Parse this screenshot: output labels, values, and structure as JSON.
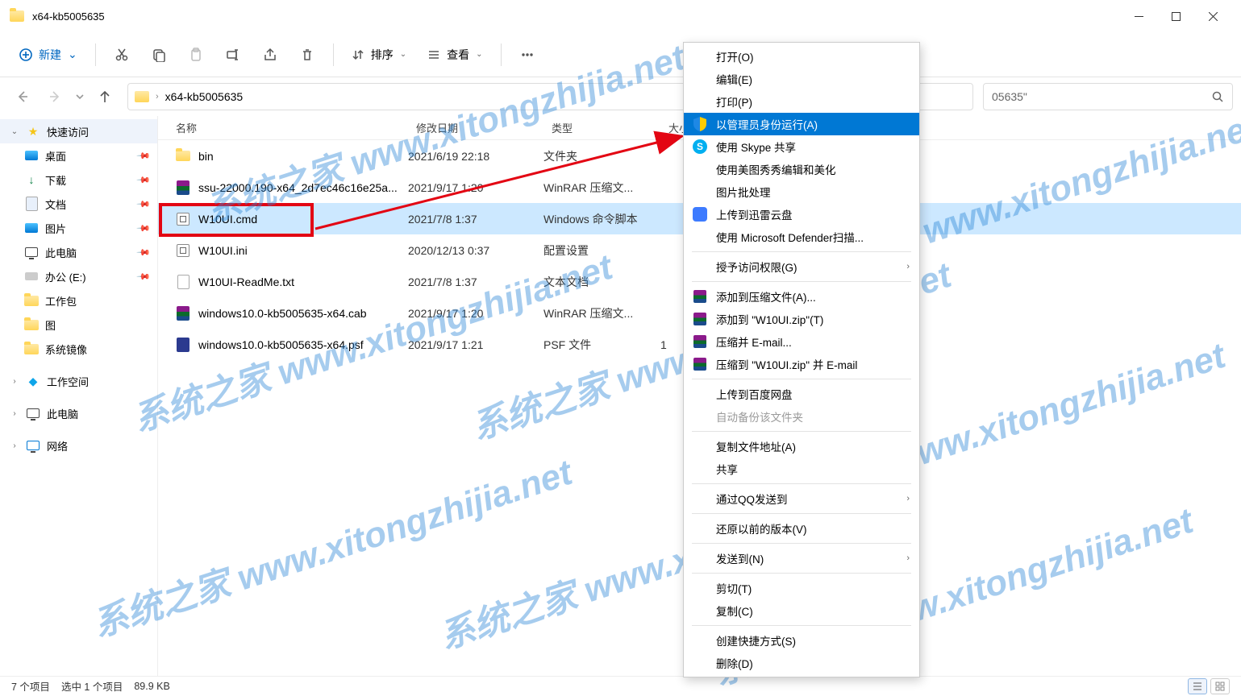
{
  "window": {
    "title": "x64-kb5005635"
  },
  "toolbar": {
    "new_label": "新建",
    "sort_label": "排序",
    "view_label": "查看"
  },
  "breadcrumb": {
    "current": "x64-kb5005635"
  },
  "search": {
    "suffix_text": "05635\""
  },
  "sidebar": {
    "quick_access": "快速访问",
    "items": [
      {
        "label": "桌面",
        "pinned": true
      },
      {
        "label": "下载",
        "pinned": true
      },
      {
        "label": "文档",
        "pinned": true
      },
      {
        "label": "图片",
        "pinned": true
      },
      {
        "label": "此电脑",
        "pinned": true
      },
      {
        "label": "办公 (E:)",
        "pinned": true
      },
      {
        "label": "工作包",
        "pinned": false
      },
      {
        "label": "图",
        "pinned": false
      },
      {
        "label": "系统镜像",
        "pinned": false
      }
    ],
    "workspace": "工作空间",
    "this_pc": "此电脑",
    "network": "网络"
  },
  "columns": {
    "name": "名称",
    "date": "修改日期",
    "type": "类型",
    "size": "大小"
  },
  "files": [
    {
      "name": "bin",
      "date": "2021/6/19 22:18",
      "type": "文件夹",
      "size": "",
      "icon": "folder"
    },
    {
      "name": "ssu-22000.190-x64_2d7ec46c16e25a...",
      "date": "2021/9/17 1:20",
      "type": "WinRAR 压缩文...",
      "size": "",
      "icon": "rar"
    },
    {
      "name": "W10UI.cmd",
      "date": "2021/7/8 1:37",
      "type": "Windows 命令脚本",
      "size": "",
      "icon": "cmd",
      "selected": true,
      "highlighted_red": true
    },
    {
      "name": "W10UI.ini",
      "date": "2020/12/13 0:37",
      "type": "配置设置",
      "size": "",
      "icon": "cmd"
    },
    {
      "name": "W10UI-ReadMe.txt",
      "date": "2021/7/8 1:37",
      "type": "文本文档",
      "size": "",
      "icon": "doc"
    },
    {
      "name": "windows10.0-kb5005635-x64.cab",
      "date": "2021/9/17 1:20",
      "type": "WinRAR 压缩文...",
      "size": "",
      "icon": "rar"
    },
    {
      "name": "windows10.0-kb5005635-x64.psf",
      "date": "2021/9/17 1:21",
      "type": "PSF 文件",
      "size": "1",
      "icon": "psf"
    }
  ],
  "context_menu": {
    "groups": [
      [
        {
          "label": "打开(O)"
        },
        {
          "label": "编辑(E)"
        },
        {
          "label": "打印(P)"
        },
        {
          "label": "以管理员身份运行(A)",
          "icon": "shield",
          "highlighted": true
        },
        {
          "label": "使用 Skype 共享",
          "icon": "skype"
        },
        {
          "label": "使用美图秀秀编辑和美化"
        },
        {
          "label": "图片批处理"
        },
        {
          "label": "上传到迅雷云盘",
          "icon": "xunlei"
        },
        {
          "label": "使用 Microsoft Defender扫描..."
        }
      ],
      [
        {
          "label": "授予访问权限(G)",
          "submenu": true
        }
      ],
      [
        {
          "label": "添加到压缩文件(A)...",
          "icon": "rar"
        },
        {
          "label": "添加到 \"W10UI.zip\"(T)",
          "icon": "rar"
        },
        {
          "label": "压缩并 E-mail...",
          "icon": "rar"
        },
        {
          "label": "压缩到 \"W10UI.zip\" 并 E-mail",
          "icon": "rar"
        }
      ],
      [
        {
          "label": "上传到百度网盘"
        },
        {
          "label": "自动备份该文件夹",
          "disabled": true
        }
      ],
      [
        {
          "label": "复制文件地址(A)"
        },
        {
          "label": "共享"
        }
      ],
      [
        {
          "label": "通过QQ发送到",
          "submenu": true
        }
      ],
      [
        {
          "label": "还原以前的版本(V)"
        }
      ],
      [
        {
          "label": "发送到(N)",
          "submenu": true
        }
      ],
      [
        {
          "label": "剪切(T)"
        },
        {
          "label": "复制(C)"
        }
      ],
      [
        {
          "label": "创建快捷方式(S)"
        },
        {
          "label": "删除(D)"
        }
      ]
    ]
  },
  "status": {
    "item_count": "7 个项目",
    "selection": "选中 1 个项目",
    "size": "89.9 KB"
  },
  "watermark": "系统之家 www.xitongzhijia.net"
}
